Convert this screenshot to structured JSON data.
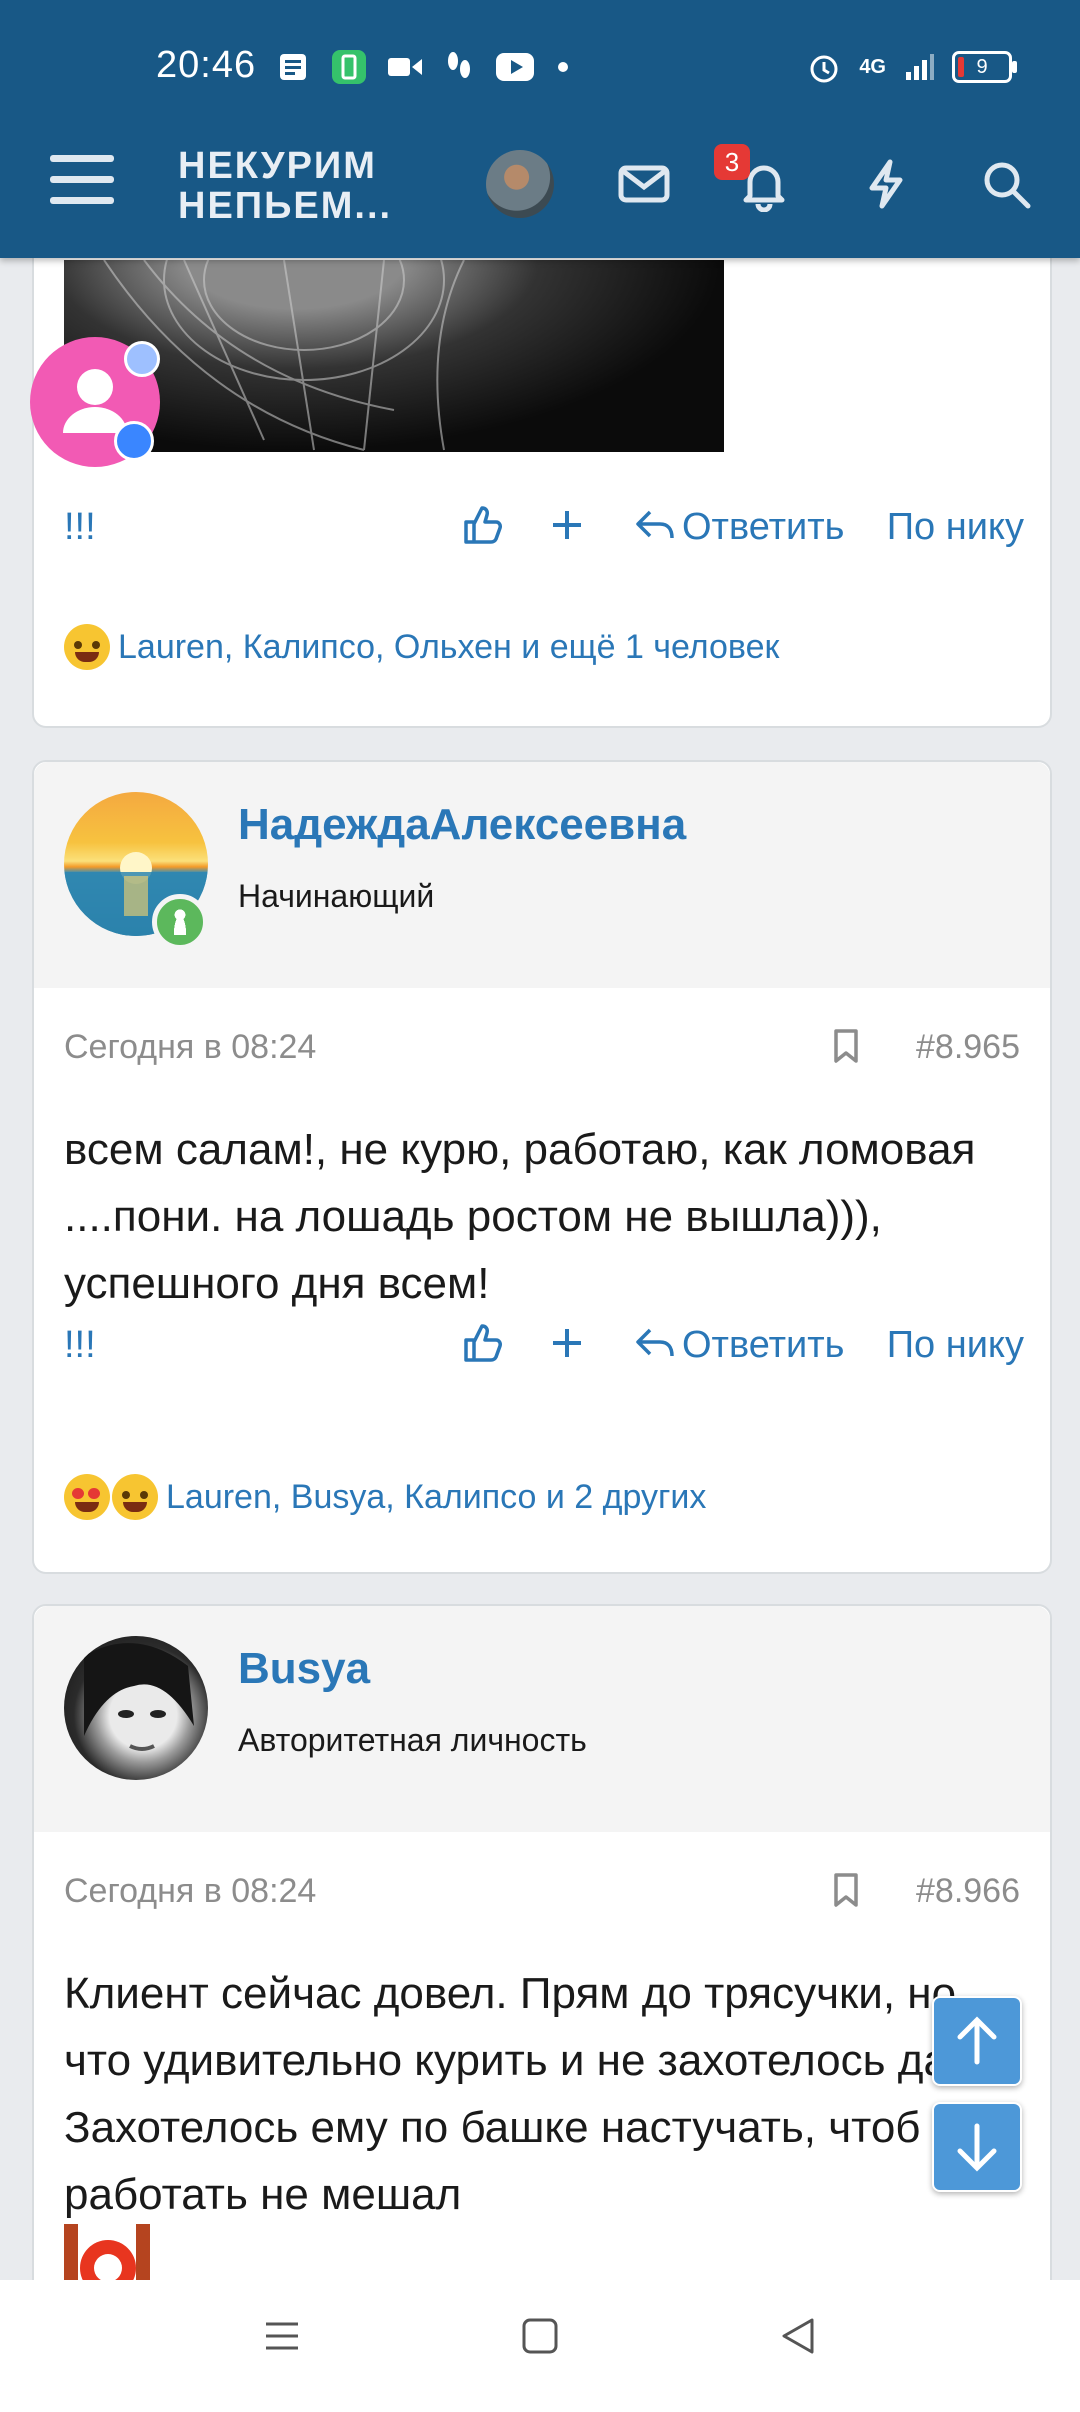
{
  "status_bar": {
    "time": "20:46",
    "network": "4G",
    "battery": "9",
    "left_icons": [
      "news-icon",
      "battery-saver-icon",
      "video-icon",
      "steps-icon",
      "youtube-icon",
      "dot-icon"
    ],
    "right_icons": [
      "alarm-icon",
      "signal-icon"
    ]
  },
  "header": {
    "logo_line1": "НЕКУРИМ",
    "logo_line2": "НЕПЬЕМ...",
    "notifications_count": "3",
    "brand_color": "#185886",
    "accent_color": "#2a77b7"
  },
  "post_top": {
    "reaction_label": "!!!",
    "reply_label": "Ответить",
    "by_nick_label": "По нику",
    "reactions_text": "Lauren, Калипсо, Ольхен и ещё 1 человек"
  },
  "post_1": {
    "username": "НадеждаАлексеевна",
    "user_title": "Начинающий",
    "time": "Сегодня в 08:24",
    "post_number": "#8.965",
    "body": "всем салам!, не курю, работаю, как ломовая ....пони. на лошадь ростом не вышла))), успешного дня всем!",
    "reaction_label": "!!!",
    "reply_label": "Ответить",
    "by_nick_label": "По нику",
    "reactions_text": "Lauren, Busya, Калипсо и 2 других"
  },
  "post_2": {
    "username": "Busya",
    "user_title": "Авторитетная личность",
    "time": "Сегодня в 08:24",
    "post_number": "#8.966",
    "body": "Клиент сейчас довел. Прям до трясучки, но что удивительно курить и не захотелось даже. Захотелось ему по башке настучать, чтоб работать не мешал"
  }
}
